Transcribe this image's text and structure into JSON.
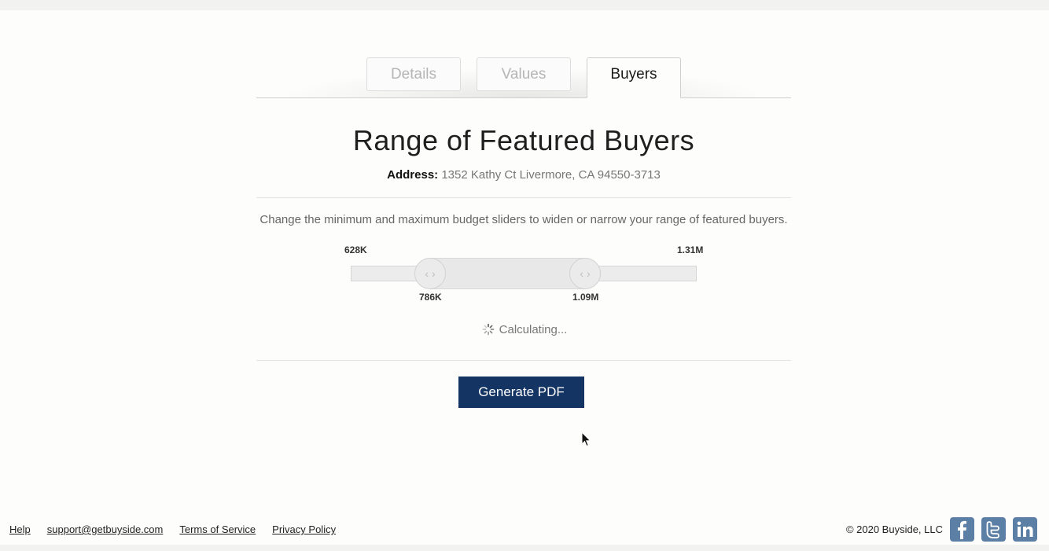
{
  "tabs": [
    {
      "label": "Details"
    },
    {
      "label": "Values"
    },
    {
      "label": "Buyers"
    }
  ],
  "active_tab": "Buyers",
  "page_title": "Range of Featured Buyers",
  "address": {
    "label": "Address:",
    "value": "1352 Kathy Ct Livermore, CA 94550-3713"
  },
  "instructions": "Change the minimum and maximum budget sliders to widen or narrow your range of featured buyers.",
  "slider": {
    "min_label": "628K",
    "max_label": "1.31M",
    "low_label": "786K",
    "high_label": "1.09M",
    "handle_glyph": "‹ ›"
  },
  "status": "Calculating...",
  "generate_button": "Generate PDF",
  "footer": {
    "links": [
      "Help",
      "support@getbuyside.com",
      "Terms of Service",
      "Privacy Policy"
    ],
    "copyright": "© 2020 Buyside, LLC"
  },
  "colors": {
    "button": "#143463",
    "social": "#5c7fa6"
  }
}
